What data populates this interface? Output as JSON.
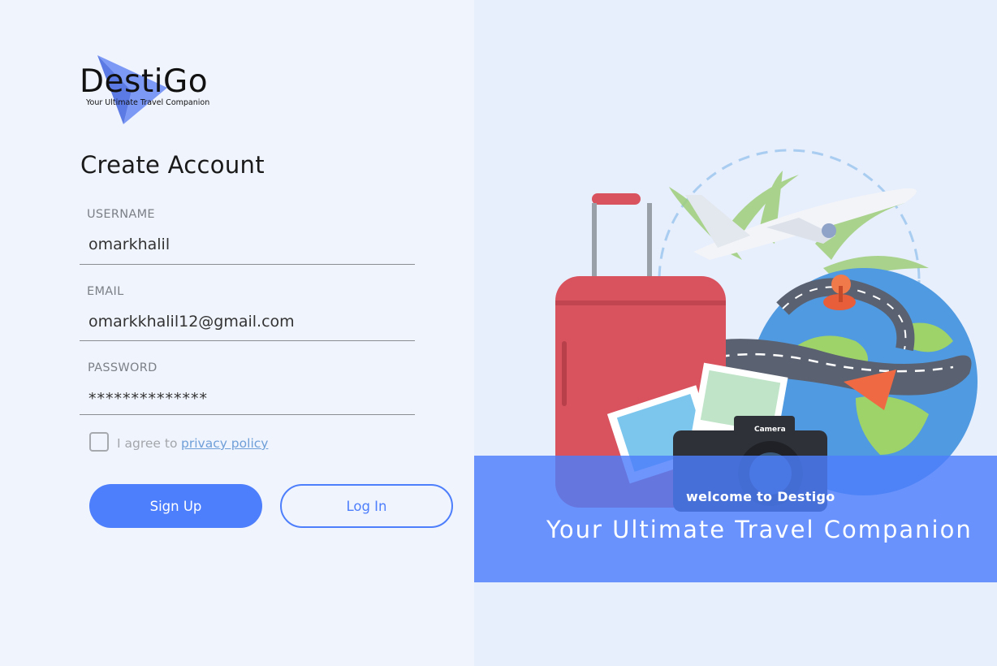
{
  "brand": {
    "name": "DestiGo",
    "tagline": "Your Ultimate Travel Companion"
  },
  "form": {
    "title": "Create Account",
    "username": {
      "label": "USERNAME",
      "value": "omarkhalil"
    },
    "email": {
      "label": "EMAIL",
      "value": "omarkkhalil12@gmail.com"
    },
    "password": {
      "label": "PASSWORD",
      "value": "**************"
    },
    "agree_text": "I agree to",
    "privacy_link": "privacy policy",
    "agree_checked": false,
    "signup_label": "Sign Up",
    "login_label": "Log In"
  },
  "hero": {
    "welcome": "welcome to Destigo",
    "tagline": "Your Ultimate Travel Companion",
    "camera_label": "Camera"
  },
  "colors": {
    "accent": "#4d7efb",
    "left_bg": "#f0f4fd",
    "right_bg": "#e7eefc",
    "suitcase": "#d9535f"
  }
}
